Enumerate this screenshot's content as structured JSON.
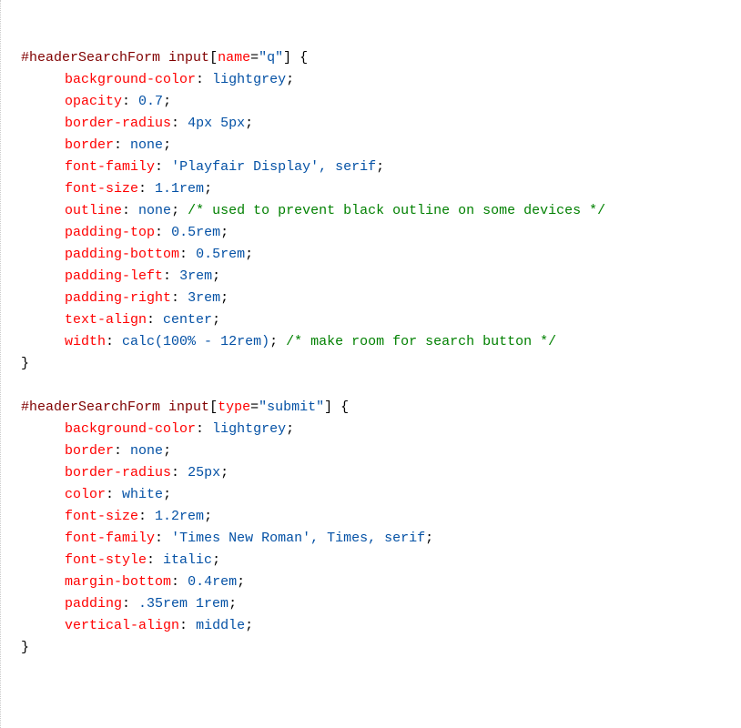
{
  "rules": [
    {
      "selector_parts": [
        "#headerSearchForm",
        " ",
        "input",
        "[",
        "name",
        "=",
        "\"q\"",
        "]"
      ],
      "decls": [
        {
          "prop": "background-color",
          "val": "lightgrey"
        },
        {
          "prop": "opacity",
          "val": "0.7"
        },
        {
          "prop": "border-radius",
          "val": "4px 5px"
        },
        {
          "prop": "border",
          "val": "none"
        },
        {
          "prop": "font-family",
          "val": "'Playfair Display', serif"
        },
        {
          "prop": "font-size",
          "val": "1.1rem"
        },
        {
          "prop": "outline",
          "val": "none",
          "comment": "/* used to prevent black outline on some devices */"
        },
        {
          "prop": "padding-top",
          "val": "0.5rem"
        },
        {
          "prop": "padding-bottom",
          "val": "0.5rem"
        },
        {
          "prop": "padding-left",
          "val": "3rem"
        },
        {
          "prop": "padding-right",
          "val": "3rem"
        },
        {
          "prop": "text-align",
          "val": "center"
        },
        {
          "prop": "width",
          "val": "calc(100% - 12rem)",
          "comment": "/* make room for search button */"
        }
      ]
    },
    {
      "selector_parts": [
        "#headerSearchForm",
        " ",
        "input",
        "[",
        "type",
        "=",
        "\"submit\"",
        "]"
      ],
      "decls": [
        {
          "prop": "background-color",
          "val": "lightgrey"
        },
        {
          "prop": "border",
          "val": "none"
        },
        {
          "prop": "border-radius",
          "val": "25px"
        },
        {
          "prop": "color",
          "val": "white"
        },
        {
          "prop": "font-size",
          "val": "1.2rem"
        },
        {
          "prop": "font-family",
          "val": "'Times New Roman', Times, serif"
        },
        {
          "prop": "font-style",
          "val": "italic"
        },
        {
          "prop": "margin-bottom",
          "val": "0.4rem"
        },
        {
          "prop": "padding",
          "val": ".35rem 1rem"
        },
        {
          "prop": "vertical-align",
          "val": "middle"
        }
      ]
    }
  ]
}
